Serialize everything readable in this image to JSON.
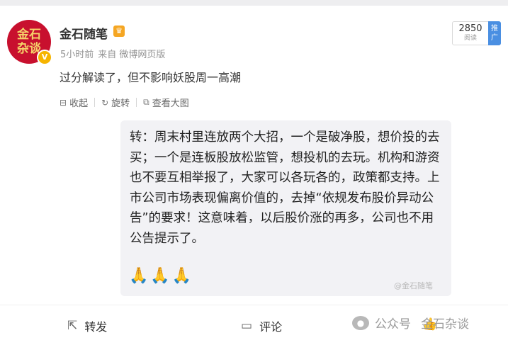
{
  "post": {
    "avatar_text": "金石杂谈",
    "author": "金石随笔",
    "time": "5小时前",
    "source": "来自 微博网页版",
    "views": "2850",
    "views_label": "阅读",
    "promote_label": "推广",
    "text": "过分解读了，但不影响妖股周一高潮"
  },
  "media_actions": [
    {
      "icon": "collapse-icon",
      "label": "收起"
    },
    {
      "icon": "rotate-icon",
      "label": "旋转"
    },
    {
      "icon": "view-large-icon",
      "label": "查看大图"
    }
  ],
  "repost_image": {
    "text": "转：周末村里连放两个大招，一个是破净股，想价投的去买；一个是连板股放松监管，想投机的去玩。机构和游资也不要互相举报了，大家可以各玩各的，政策都支持。上市公司市场表现偏离价值的，去掉“依规发布股价异动公告”的要求！这意味着，以后股价涨的再多，公司也不用公告提示了。",
    "emojis": "🙏🙏🙏",
    "watermark": "@金石随笔"
  },
  "bottom_actions": {
    "repost": "转发",
    "comment": "评论",
    "like_icon": "like-icon"
  },
  "wechat_overlay": {
    "label": "公众号",
    "account": "金石杂谈"
  },
  "colors": {
    "avatar_bg": "#c8102e",
    "promote_bg": "#4a8fe2",
    "vip_badge": "#f6b400"
  }
}
